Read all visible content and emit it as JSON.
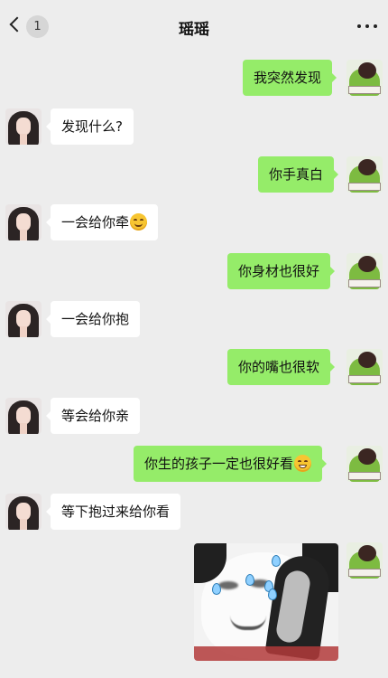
{
  "header": {
    "unread_count": "1",
    "title": "瑶瑶"
  },
  "icons": {
    "back": "chevron-left-icon",
    "more": "more-dots-icon",
    "smile": "smile-emoji-icon",
    "grin": "grin-emoji-icon"
  },
  "colors": {
    "background": "#ededed",
    "outgoing_bubble": "#95ec69",
    "incoming_bubble": "#ffffff"
  },
  "messages": [
    {
      "side": "out",
      "text": "我突然发现"
    },
    {
      "side": "in",
      "text": "发现什么?"
    },
    {
      "side": "out",
      "text": "你手真白"
    },
    {
      "side": "in",
      "text": "一会给你牵",
      "emoji": "smile"
    },
    {
      "side": "out",
      "text": "你身材也很好"
    },
    {
      "side": "in",
      "text": "一会给你抱"
    },
    {
      "side": "out",
      "text": "你的嘴也很软"
    },
    {
      "side": "in",
      "text": "等会给你亲"
    },
    {
      "side": "out",
      "text": "你生的孩子一定也很好看",
      "emoji": "grin"
    },
    {
      "side": "in",
      "text": "等下抱过来给你看"
    },
    {
      "side": "out",
      "type": "sticker",
      "sticker": "panda-face-sweat-sticker"
    }
  ]
}
